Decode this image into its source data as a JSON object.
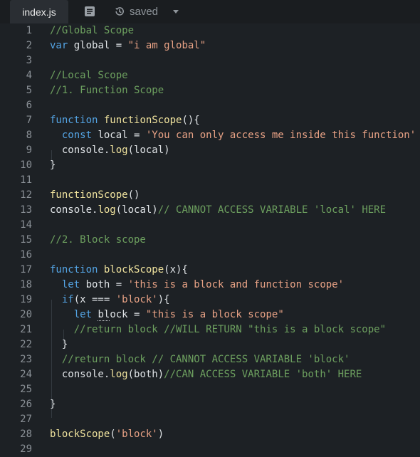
{
  "tabbar": {
    "tab_label": "index.js",
    "status": "saved",
    "icons": [
      "format-icon",
      "history-icon",
      "caret-down-icon"
    ]
  },
  "editor": {
    "line_numbers": [
      "1",
      "2",
      "3",
      "4",
      "5",
      "6",
      "7",
      "8",
      "9",
      "10",
      "11",
      "12",
      "13",
      "14",
      "15",
      "16",
      "17",
      "18",
      "19",
      "20",
      "21",
      "22",
      "23",
      "24",
      "25",
      "26",
      "27",
      "28",
      "29"
    ],
    "lines": [
      "//Global Scope",
      "var global = \"i am global\"",
      "",
      "//Local Scope",
      "//1. Function Scope",
      "",
      "function functionScope(){",
      "  const local = 'You can only access me inside this function'",
      "  console.log(local)",
      "}",
      "",
      "functionScope()",
      "console.log(local)// CANNOT ACCESS VARIABLE 'local' HERE",
      "",
      "//2. Block scope",
      "",
      "function blockScope(x){",
      "  let both = 'this is a block and function scope'",
      "  if(x === 'block'){",
      "    let block = \"this is a block scope\"",
      "    //return block //WILL RETURN \"this is a block scope\"",
      "  }",
      "  //return block // CANNOT ACCESS VARIABLE 'block'",
      "  console.log(both)//CAN ACCESS VARIABLE 'both' HERE",
      "",
      "}",
      "",
      "blockScope('block')",
      ""
    ]
  },
  "colors": {
    "background": "#1d2125",
    "keyword": "#54a4e4",
    "string": "#e8a285",
    "comment": "#6da05f",
    "function": "#f0e39e",
    "text": "#dfe3e6"
  }
}
